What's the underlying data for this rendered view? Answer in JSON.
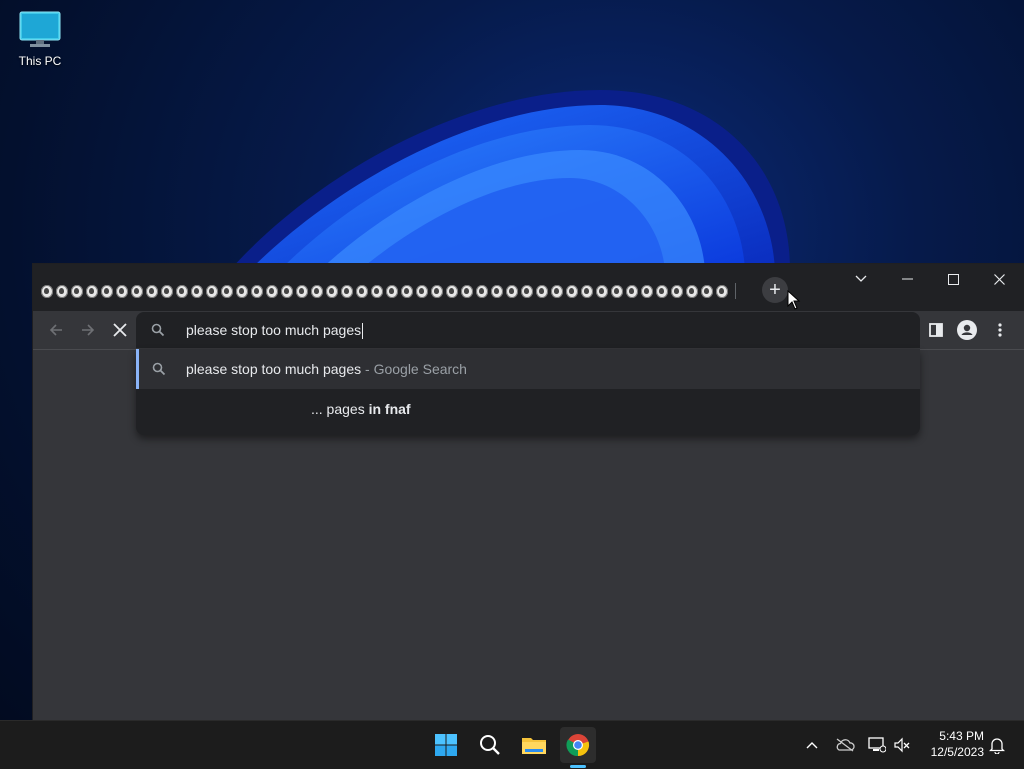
{
  "desktop": {
    "icons": [
      {
        "label": "This PC",
        "icon": "monitor-icon"
      }
    ]
  },
  "browser": {
    "tab_count_visible": 46,
    "tab_favicon": "fnaf-favicon",
    "new_tab_label": "+",
    "address_bar": {
      "value": "please stop too much pages"
    },
    "suggestions": [
      {
        "text": "please stop too much pages",
        "separator": " - ",
        "source": "Google Search",
        "selected": true
      },
      {
        "prefix": "... pages ",
        "bold": "in fnaf",
        "selected": false
      }
    ]
  },
  "taskbar": {
    "apps": [
      "start-icon",
      "search-icon",
      "file-explorer-icon",
      "chrome-icon"
    ],
    "active_app": "chrome-icon",
    "time": "5:43 PM",
    "date": "12/5/2023"
  },
  "colors": {
    "accent": "#8ab4f8",
    "window_bg": "#35363a",
    "titlebar_bg": "#202124",
    "taskbar_bg": "#1c1c1c"
  }
}
